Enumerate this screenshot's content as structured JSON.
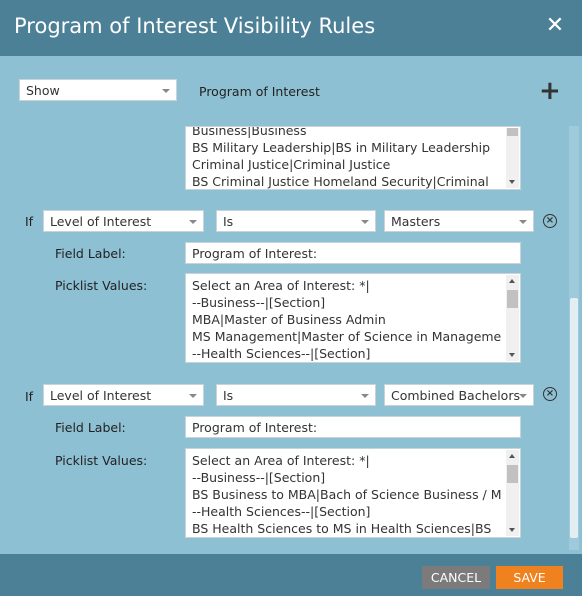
{
  "dialog": {
    "title": "Program of Interest Visibility Rules",
    "close_icon": "close-icon"
  },
  "top_rule": {
    "action_select": "Show",
    "field_label": "Program of Interest",
    "add_icon": "plus-icon",
    "default_list": [
      "Business|Business",
      "BS Military Leadership|BS in Military Leadership",
      "Criminal Justice|Criminal Justice",
      "BS Criminal Justice Homeland Security|Criminal"
    ]
  },
  "rules": [
    {
      "if_label": "If",
      "field": "Level of Interest",
      "operator": "Is",
      "value": "Masters",
      "field_label_caption": "Field Label:",
      "field_label_value": "Program of Interest:",
      "picklist_caption": "Picklist Values:",
      "picklist": [
        "Select an Area of Interest: *|",
        "--Business--|[Section]",
        "MBA|Master of Business Admin",
        "MS Management|Master of Science in Management",
        "--Health Sciences--|[Section]"
      ]
    },
    {
      "if_label": "If",
      "field": "Level of Interest",
      "operator": "Is",
      "value": "Combined Bachelors",
      "field_label_caption": "Field Label:",
      "field_label_value": "Program of Interest:",
      "picklist_caption": "Picklist Values:",
      "picklist": [
        "Select an Area of Interest: *|",
        "--Business--|[Section]",
        "BS Business to MBA|Bach of Science Business / MBA",
        "--Health Sciences--|[Section]",
        "BS Health Sciences to MS in Health Sciences|BS"
      ]
    }
  ],
  "footer": {
    "cancel_label": "CANCEL",
    "save_label": "SAVE"
  },
  "colors": {
    "header": "#4c8096",
    "body": "#8ec0d3",
    "save": "#f0811f",
    "cancel": "#7b7b7b"
  }
}
